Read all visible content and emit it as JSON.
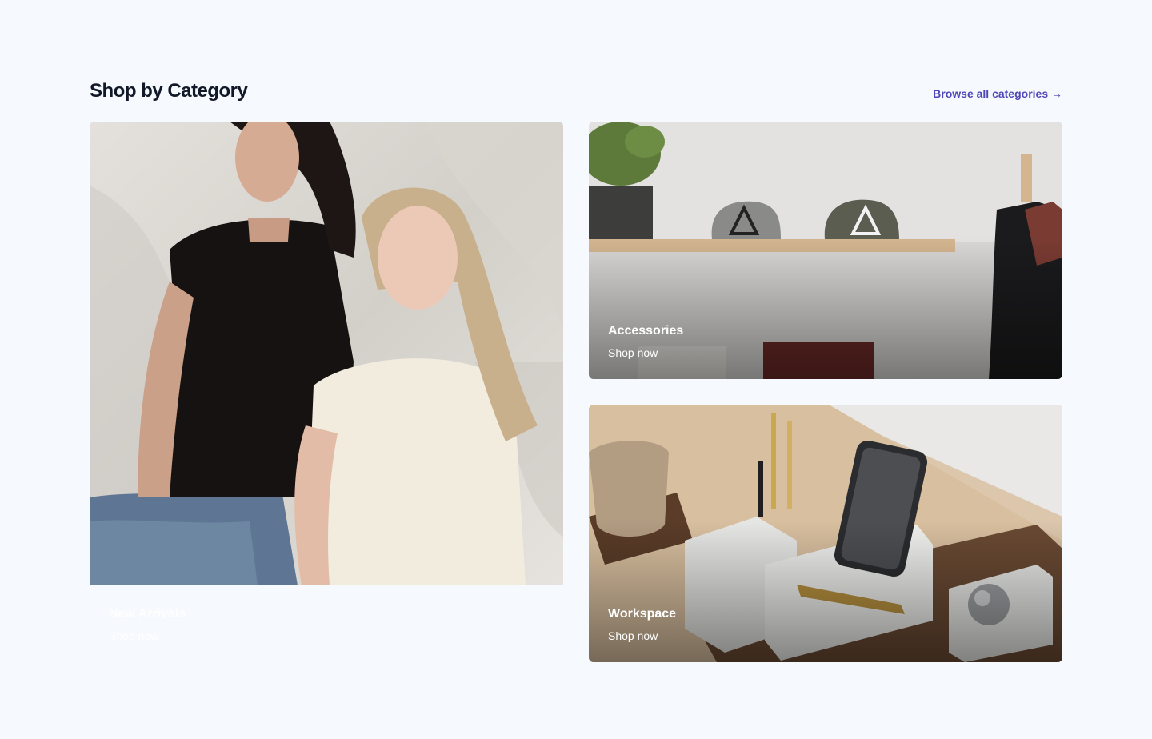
{
  "section": {
    "title": "Shop by Category",
    "browse_link": "Browse all categories →"
  },
  "categories": [
    {
      "name": "New Arrivals",
      "cta": "Shop now",
      "image": "two-women-tshirts-photo"
    },
    {
      "name": "Accessories",
      "cta": "Shop now",
      "image": "shelf-with-hats-photo"
    },
    {
      "name": "Workspace",
      "cta": "Shop now",
      "image": "desk-organizer-photo"
    }
  ],
  "colors": {
    "background": "#f6f9fd",
    "heading": "#111827",
    "accent_link": "#4f46b8",
    "card_text": "#ffffff"
  }
}
